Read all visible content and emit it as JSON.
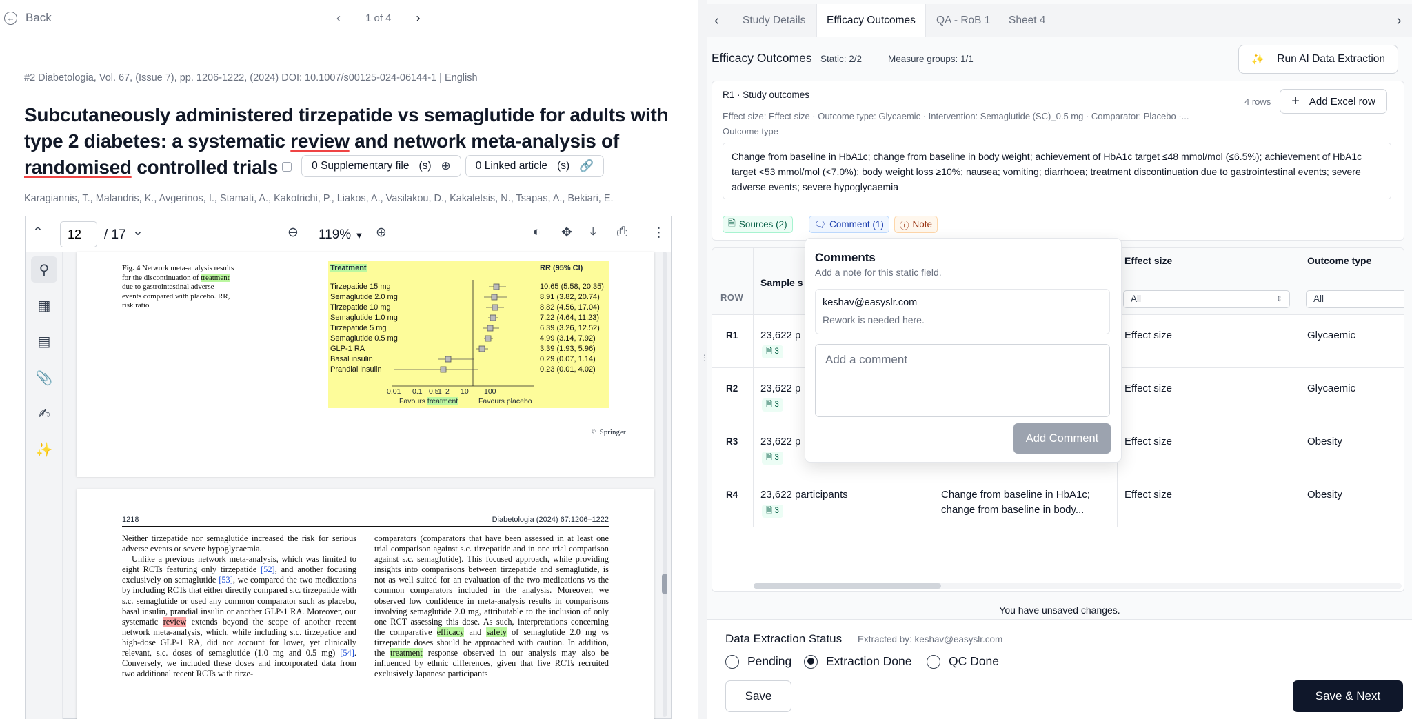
{
  "nav": {
    "back_label": "Back",
    "pager_text": "1 of 4"
  },
  "article": {
    "meta": "#2 Diabetologia, Vol. 67, (Issue 7), pp. 1206-1222, (2024) DOI: 10.1007/s00125-024-06144-1 | English",
    "title_parts": [
      "Subcutaneously administered tirzepatide vs semaglutide for adults with type 2 diabetes: a systematic ",
      "review",
      " and network meta-analysis of ",
      "randomised",
      " controlled trials"
    ],
    "supplementary_label": "0 Supplementary file",
    "supplementary_suffix": "(s)",
    "linked_label": "0 Linked article",
    "linked_suffix": "(s)",
    "authors": "Karagiannis, T., Malandris, K., Avgerinos, I., Stamati, A., Kakotrichi, P., Liakos, A., Vasilakou, D., Kakaletsis, N., Tsapas, A., Bekiari, E."
  },
  "pdf": {
    "page_current": "12",
    "page_total": "/ 17",
    "zoom": "119%",
    "fig_label": "Fig. 4",
    "fig_caption_1": " Network meta-analysis results for the discontinuation of ",
    "fig_caption_hl": "treatment",
    "fig_caption_2": " due to gastrointestinal adverse events compared with placebo. RR, risk ratio",
    "forest_header_left": "Treatment",
    "forest_header_right": "RR (95% CI)",
    "forest_rows": [
      {
        "name": "Tirzepatide 15 mg",
        "rr": "10.65 (5.58, 20.35)"
      },
      {
        "name": "Semaglutide 2.0 mg",
        "rr": "8.91 (3.82, 20.74)"
      },
      {
        "name": "Tirzepatide 10 mg",
        "rr": "8.82 (4.56, 17.04)"
      },
      {
        "name": "Semaglutide 1.0 mg",
        "rr": "7.22 (4.64, 11.23)"
      },
      {
        "name": "Tirzepatide 5 mg",
        "rr": "6.39 (3.26, 12.52)"
      },
      {
        "name": "Semaglutide 0.5 mg",
        "rr": "4.99 (3.14, 7.92)"
      },
      {
        "name": "GLP-1 RA",
        "rr": "3.39 (1.93, 5.96)"
      },
      {
        "name": "Basal insulin",
        "rr": "0.29 (0.07, 1.14)"
      },
      {
        "name": "Prandial insulin",
        "rr": "0.23 (0.01, 4.02)"
      }
    ],
    "forest_ticks": [
      "0.01",
      "0.1",
      "0.5",
      "1",
      "2",
      "10",
      "100"
    ],
    "favours_left_1": "Favours ",
    "favours_left_hl": "treatment",
    "favours_right": "Favours placebo",
    "springer": "Springer",
    "p2_page_no": "1218",
    "p2_journal": "Diabetologia (2024) 67:1206–1222",
    "col1_a": "Neither tirzepatide nor semaglutide increased the risk for serious adverse events or severe hypoglycaemia.",
    "col1_b": "Unlike a previous network meta-analysis, which was limited to eight RCTs featuring only tirzepatide ",
    "col1_ref1": "[52]",
    "col1_c": ", and another focusing exclusively on semaglutide ",
    "col1_ref2": "[53]",
    "col1_d": ", we compared the two medications by including RCTs that either directly compared s.c. tirzepatide with s.c. semaglutide or used any common comparator such as placebo, basal insulin, prandial insulin or another GLP-1 RA. Moreover, our systematic ",
    "col1_hl": "review",
    "col1_e": " extends beyond the scope of another recent network meta-analysis, which, while including s.c. tirzepatide and high-dose GLP-1 RA, did not account for lower, yet clinically relevant, s.c. doses of semaglutide (1.0 mg and 0.5 mg) ",
    "col1_ref3": "[54]",
    "col1_f": ". Conversely, we included these doses and incorporated data from two additional recent RCTs with tirze-",
    "col2_a": "comparators (comparators that have been assessed in at least one trial comparison against s.c. tirzepatide and in one trial comparison against s.c. semaglutide). This focused approach, while providing insights into comparisons between tirzepatide and semaglutide, is not as well suited for an evaluation of the two medications vs the common comparators included in the analysis. Moreover, we observed low confidence in meta-analysis results in comparisons involving semaglutide 2.0 mg, attributable to the inclusion of only one RCT assessing this dose. As such, interpretations concerning the comparative ",
    "col2_hl1": "efficacy",
    "col2_b": " and ",
    "col2_hl2": "safety",
    "col2_c": " of semaglutide 2.0 mg vs tirzepatide doses should be approached with caution. In addition, the ",
    "col2_hl3": "treatment",
    "col2_d": " response observed in our analysis may also be influenced by ethnic differences, given that five RCTs recruited exclusively Japanese participants"
  },
  "tabs": [
    {
      "label": "Study Details"
    },
    {
      "label": "Efficacy Outcomes"
    },
    {
      "label": "QA - RoB 1"
    },
    {
      "label": "Sheet 4"
    }
  ],
  "efficacy": {
    "title": "Efficacy Outcomes",
    "static_stat": "Static: 2/2",
    "groups_stat": "Measure groups: 1/1",
    "run_ai_label": "Run AI Data Extraction"
  },
  "card": {
    "title": "R1 · Study outcomes",
    "rows_count": "4 rows",
    "add_row_label": "Add Excel row",
    "subtitle": "Effect size: Effect size · Outcome type: Glycaemic · Intervention: Semaglutide (SC)_0.5 mg · Comparator: Placebo ·...",
    "field_label": "Outcome type",
    "field_value": "Change from baseline in HbA1c; change from baseline in body weight; achievement of HbA1c target ≤48 mmol/mol (≤6.5%); achievement of HbA1c target <53 mmol/mol (<7.0%); body weight loss ≥10%; nausea; vomiting; diarrhoea; treatment discontinuation due to gastrointestinal events; severe adverse events; severe hypoglycaemia",
    "sources_label": "Sources (2)",
    "comment_label": "Comment (1)",
    "note_label": "Note"
  },
  "table": {
    "row_header": "ROW",
    "col_sample": "Sample s",
    "col_effect": "Effect size",
    "col_outcome": "Outcome type",
    "filter_all": "All",
    "rows": [
      {
        "id": "R1",
        "sample": "23,622 p",
        "badge": "3",
        "outcome_text": "",
        "effect": "Effect size",
        "type": "Glycaemic"
      },
      {
        "id": "R2",
        "sample": "23,622 p",
        "badge": "3",
        "outcome_text": "",
        "effect": "Effect size",
        "type": "Glycaemic"
      },
      {
        "id": "R3",
        "sample": "23,622 p",
        "badge": "3",
        "outcome_text": "",
        "effect": "Effect size",
        "type": "Obesity"
      },
      {
        "id": "R4",
        "sample": "23,622 participants",
        "badge": "3",
        "outcome_text": "Change from baseline in HbA1c; change from baseline in body...",
        "effect": "Effect size",
        "type": "Obesity"
      }
    ]
  },
  "comments": {
    "title": "Comments",
    "subtitle": "Add a note for this static field.",
    "author": "keshav@easyslr.com",
    "message": "Rework is needed here.",
    "placeholder": "Add a comment",
    "submit_label": "Add Comment"
  },
  "status": {
    "unsaved": "You have unsaved changes.",
    "title": "Data Extraction Status",
    "extracted_by": "Extracted by: keshav@easyslr.com",
    "options": [
      {
        "label": "Pending",
        "selected": false
      },
      {
        "label": "Extraction Done",
        "selected": true
      },
      {
        "label": "QC Done",
        "selected": false
      }
    ],
    "save_label": "Save",
    "save_next_label": "Save & Next"
  },
  "colors": {
    "primary_dark": "#0f172a",
    "highlight_green": "#bbf7a0",
    "highlight_red": "#fca5a5",
    "figure_yellow": "#fdfc9a"
  }
}
